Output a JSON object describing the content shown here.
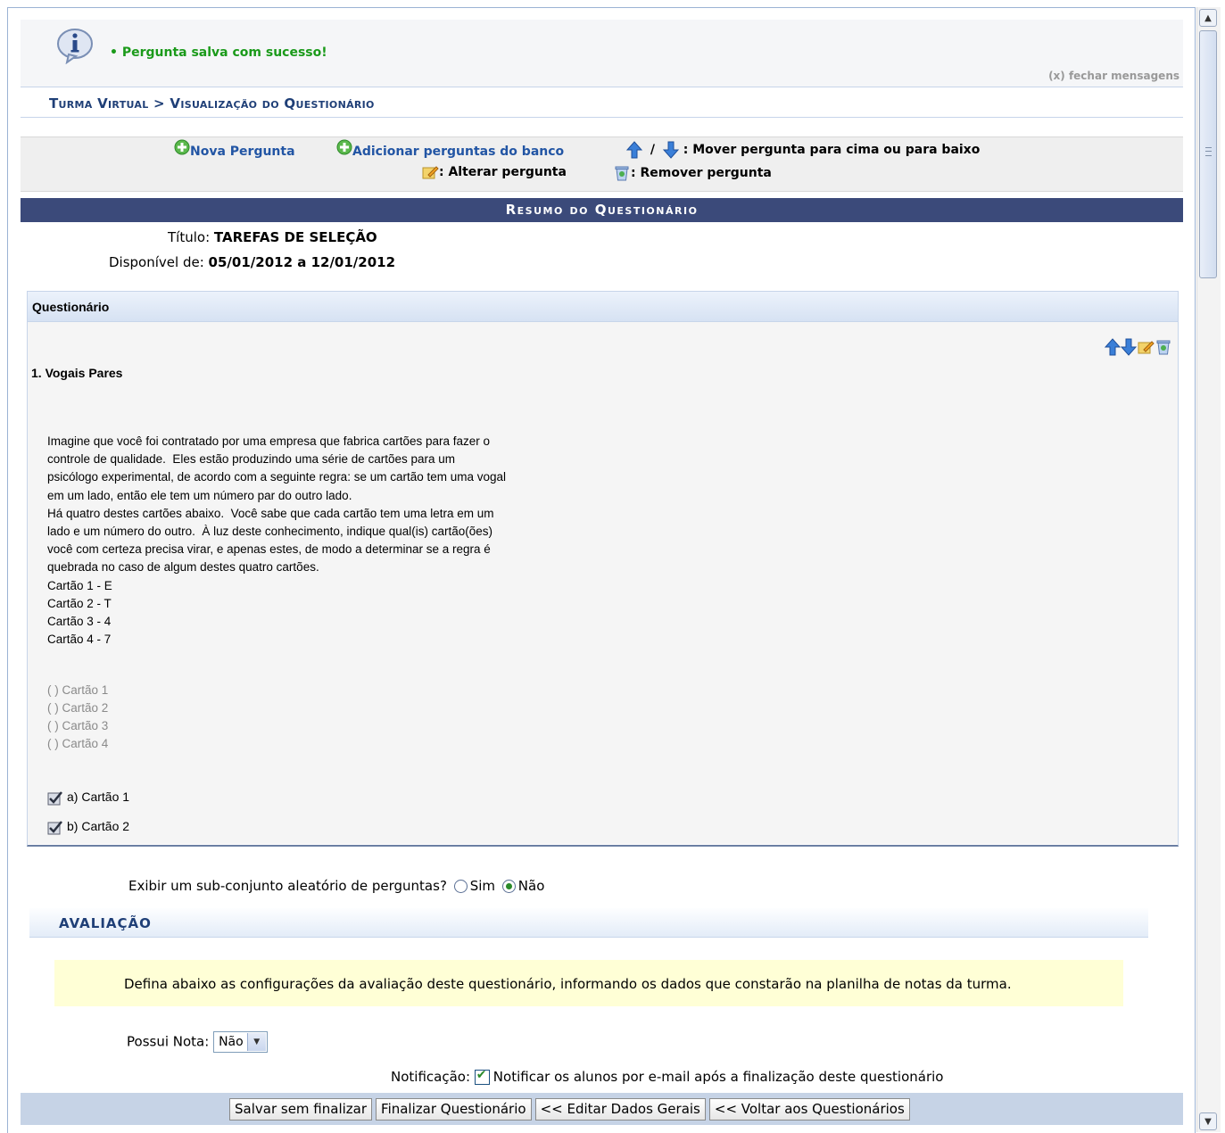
{
  "message": {
    "text": "• Pergunta salva com sucesso!",
    "close": "(x) fechar mensagens"
  },
  "breadcrumb": "Turma Virtual > Visualização do Questionário",
  "toolbar": {
    "new_question": "Nova Pergunta",
    "add_from_bank": "Adicionar perguntas do banco",
    "move_sep": "/",
    "move_legend": ": Mover pergunta para cima ou para baixo",
    "edit_legend": ": Alterar pergunta",
    "remove_legend": ": Remover pergunta"
  },
  "summary": {
    "heading": "Resumo do Questionário",
    "title_label": "Título:",
    "title_value": "TAREFAS DE SELEÇÃO",
    "available_label": "Disponível de:",
    "available_value": "05/01/2012 a 12/01/2012"
  },
  "questionnaire": {
    "header": "Questionário",
    "question_title": "1. Vogais Pares",
    "text_lines": [
      "Imagine que você foi contratado por uma empresa que fabrica cartões para fazer o",
      "controle de qualidade.  Eles estão produzindo uma série de cartões para um",
      "psicólogo experimental, de acordo com a seguinte regra: se um cartão tem uma vogal",
      "em um lado, então ele tem um número par do outro lado.",
      "Há quatro destes cartões abaixo.  Você sabe que cada cartão tem uma letra em um",
      "lado e um número do outro.  À luz deste conhecimento, indique qual(is) cartão(ões)",
      "você com certeza precisa virar, e apenas estes, de modo a determinar se a regra é",
      "quebrada no caso de algum destes quatro cartões.",
      "Cartão 1 - E",
      "Cartão 2 - T",
      "Cartão 3 - 4",
      "Cartão 4 - 7"
    ],
    "options": [
      "( ) Cartão 1",
      "( ) Cartão 2",
      "( ) Cartão 3",
      "( ) Cartão 4"
    ],
    "answers": [
      "a) Cartão 1",
      "b) Cartão 2"
    ]
  },
  "subset": {
    "question": "Exibir um sub-conjunto aleatório de perguntas?",
    "yes": "Sim",
    "no": "Não",
    "selected": "Não"
  },
  "evaluation": {
    "heading": "AVALIAÇÃO",
    "notice": "Defina abaixo as configurações da avaliação deste questionário, informando os dados que constarão na planilha de notas da turma.",
    "grade_label": "Possui Nota:",
    "grade_value": "Não",
    "notification_label": "Notificação:",
    "notification_text": "Notificar os alunos por e-mail após a finalização deste questionário",
    "notification_checked": true
  },
  "buttons": {
    "save": "Salvar sem finalizar",
    "finish": "Finalizar Questionário",
    "edit": "<< Editar Dados Gerais",
    "back": "<< Voltar aos Questionários"
  },
  "colors": {
    "success": "#1a9a1a",
    "header_bar": "#3b4a7a",
    "link": "#2255a4",
    "notice_bg": "#ffffd6"
  }
}
